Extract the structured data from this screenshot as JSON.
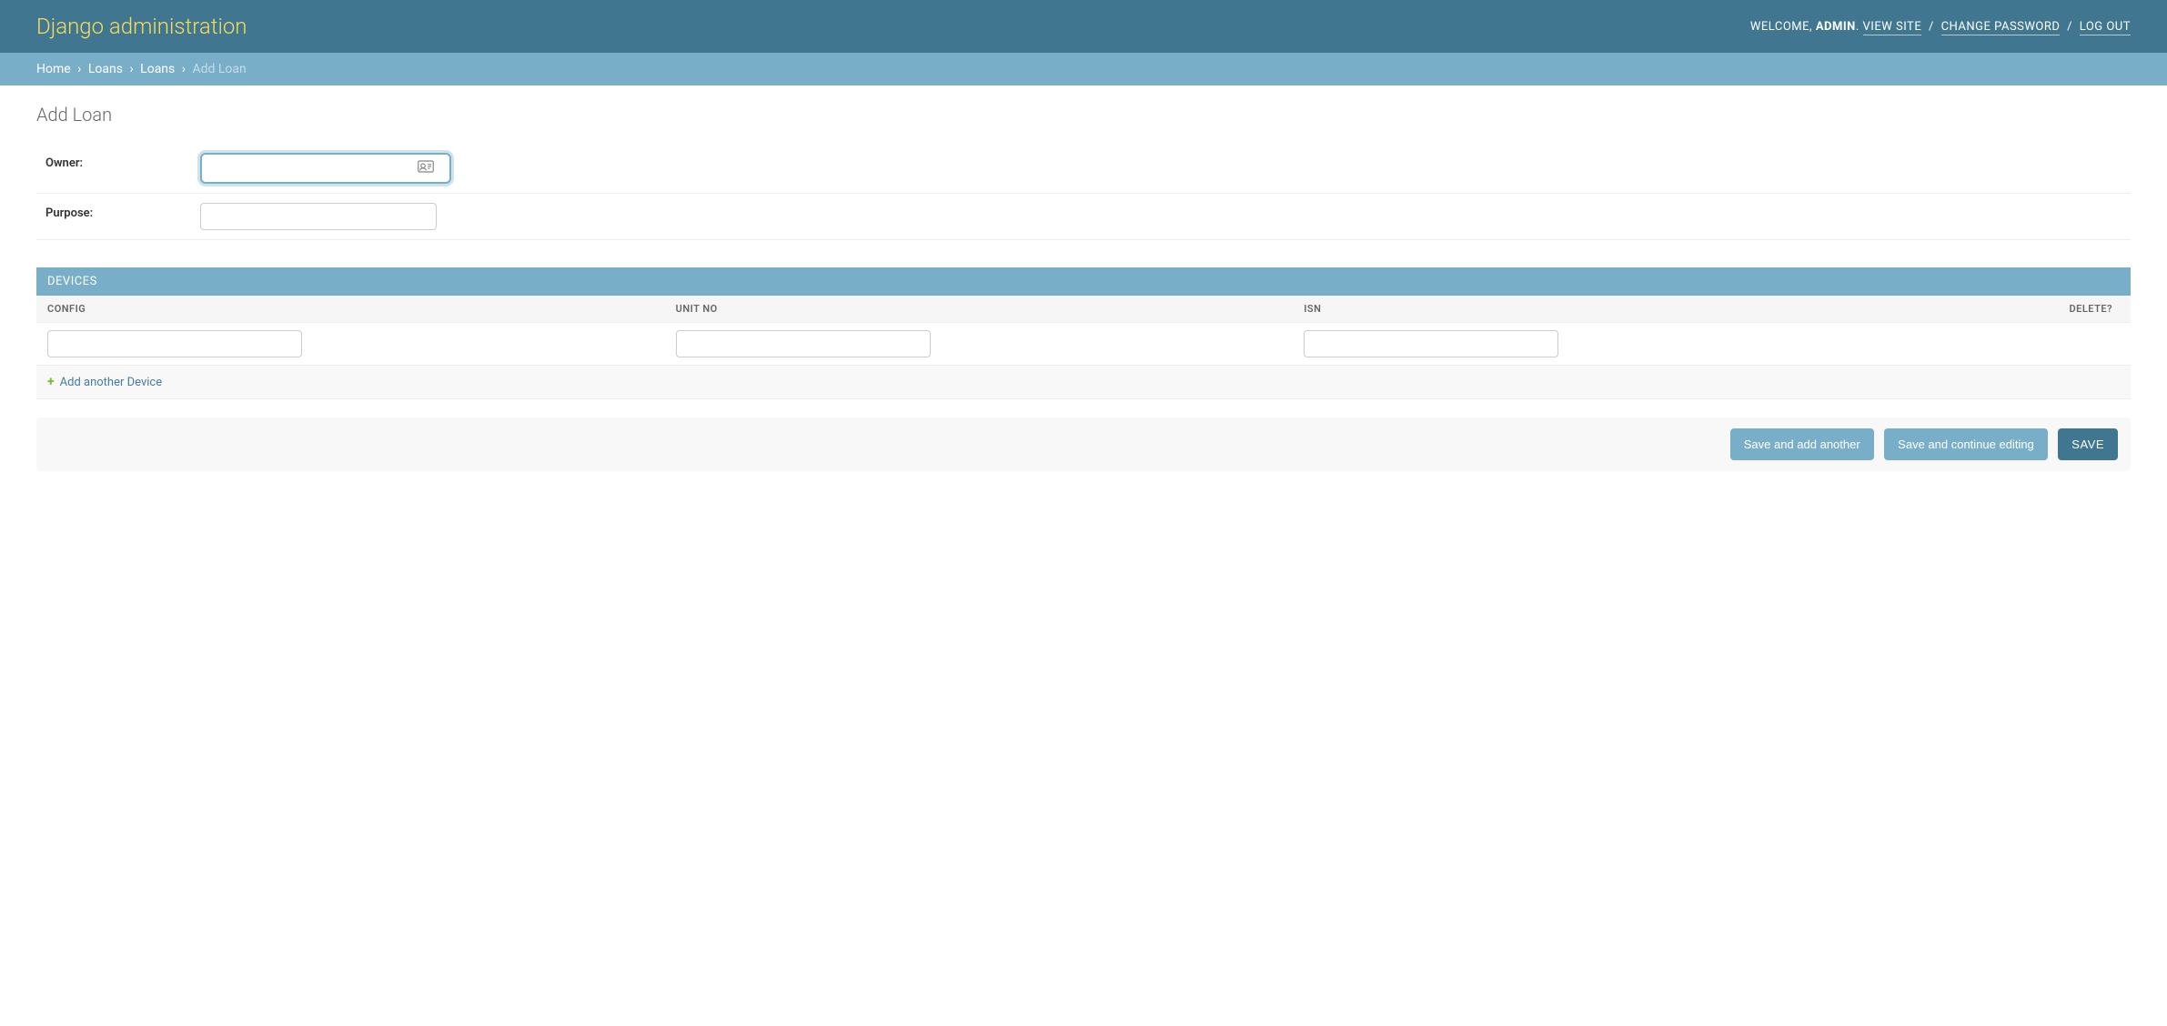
{
  "branding": {
    "title": "Django administration"
  },
  "user_tools": {
    "welcome": "WELCOME,",
    "username": "ADMIN",
    "view_site": "VIEW SITE",
    "change_password": "CHANGE PASSWORD",
    "log_out": "LOG OUT",
    "dot": ".",
    "slash": "/"
  },
  "breadcrumbs": {
    "home": "Home",
    "app": "Loans",
    "model": "Loans",
    "current": "Add Loan",
    "sep": "›"
  },
  "page": {
    "title": "Add Loan"
  },
  "form": {
    "owner_label": "Owner:",
    "owner_value": "",
    "purpose_label": "Purpose:",
    "purpose_value": ""
  },
  "inline": {
    "title": "DEVICES",
    "columns": {
      "config": "CONFIG",
      "unit_no": "UNIT NO",
      "isn": "ISN",
      "delete": "DELETE?"
    },
    "rows": [
      {
        "config": "",
        "unit_no": "",
        "isn": ""
      }
    ],
    "add_label": "Add another Device"
  },
  "submit": {
    "save_add_another": "Save and add another",
    "save_continue": "Save and continue editing",
    "save": "SAVE"
  }
}
